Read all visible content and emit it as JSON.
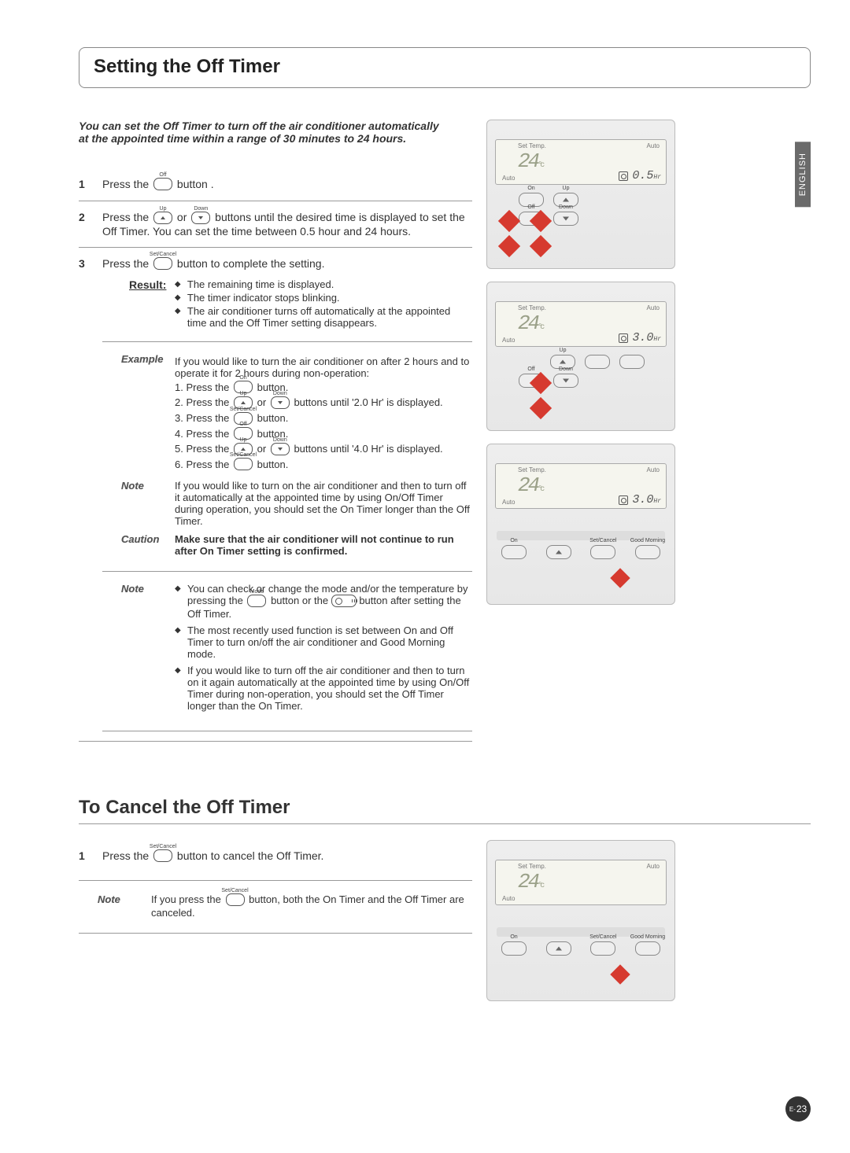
{
  "language_tab": "ENGLISH",
  "page_number": "23",
  "page_number_prefix": "E-",
  "section1": {
    "title": "Setting the Off Timer",
    "intro": "You can set the Off Timer to turn off the air conditioner automatically at the appointed time within a range of 30 minutes to 24 hours.",
    "steps": [
      {
        "num": "1",
        "pre": "Press the",
        "btn_label": "Off",
        "post": "button ."
      },
      {
        "num": "2",
        "pre": "Press the",
        "btn1_label": "Up",
        "mid": "or",
        "btn2_label": "Down",
        "post": "buttons until the desired time is displayed to set the Off Timer. You can set the time between 0.5 hour and 24 hours."
      },
      {
        "num": "3",
        "pre": "Press the",
        "btn_label": "Set/Cancel",
        "post": "button to complete the setting.",
        "result_label": "Result:",
        "results": [
          "The remaining time is displayed.",
          "The timer indicator stops blinking.",
          "The air conditioner turns off automatically at the appointed time and the Off Timer setting disappears."
        ]
      }
    ],
    "example": {
      "tag": "Example",
      "heading_a": "If you would like to turn the air conditioner on after 2 hours and to operate it for 2 hours during non-operation:",
      "lines": {
        "l1a": "1. Press the",
        "l1_btn": "On",
        "l1b": "button.",
        "l2a": "2. Press the",
        "l2_up": "Up",
        "l2_mid": "or",
        "l2_down": "Down",
        "l2b": "buttons until '2.0 Hr' is displayed.",
        "l3a": "3. Press the",
        "l3_btn": "Set/Cancel",
        "l3b": "button.",
        "l4a": "4. Press the",
        "l4_btn": "Off",
        "l4b": "button.",
        "l5a": "5. Press the",
        "l5_up": "Up",
        "l5_mid": "or",
        "l5_down": "Down",
        "l5b": "buttons until '4.0 Hr' is displayed.",
        "l6a": "6. Press the",
        "l6_btn": "Set/Cancel",
        "l6b": "button."
      }
    },
    "note1": {
      "tag": "Note",
      "text": "If you would like to turn on the air conditioner and then to turn off it automatically at the appointed time by using On/Off Timer during operation, you should set the On Timer longer than the Off Timer."
    },
    "caution": {
      "tag": "Caution",
      "text": "Make sure that the air conditioner will not continue to run after On Timer setting is confirmed."
    },
    "note2": {
      "tag": "Note",
      "b1a": "You can check or change the mode and/or the temperature by pressing the",
      "b1_mode": "Mode",
      "b1b": "button or the",
      "b1c": "button after setting the Off Timer.",
      "b2": "The most recently used function is set between On and Off Timer to turn on/off the air conditioner and Good Morning mode.",
      "b3": "If you would like to turn off the air conditioner and then to turn on it again automatically at the appointed time by using On/Off Timer during non-operation, you should set the Off Timer longer than the On Timer."
    }
  },
  "section2": {
    "title": "To Cancel the Off Timer",
    "step": {
      "num": "1",
      "pre": "Press the",
      "btn_label": "Set/Cancel",
      "post": "button to cancel the Off Timer."
    },
    "note": {
      "tag": "Note",
      "pre": "If you press the",
      "btn_label": "Set/Cancel",
      "post": "button, both the On Timer and the Off Timer are canceled."
    }
  },
  "figures": {
    "lcd_set_temp": "Set Temp.",
    "lcd_auto": "Auto",
    "lcd_temp": "24",
    "lcd_temp_unit": "°c",
    "fig1_timer": "0.5",
    "fig1_timer_unit": "Hr",
    "fig2_timer": "3.0",
    "fig2_timer_unit": "Hr",
    "fig3_timer": "3.0",
    "fig3_timer_unit": "Hr",
    "btn_on": "On",
    "btn_off": "Off",
    "btn_up": "Up",
    "btn_down": "Down",
    "btn_setcancel": "Set/Cancel",
    "btn_goodmorn": "Good Morning",
    "clock_off": "Off"
  }
}
